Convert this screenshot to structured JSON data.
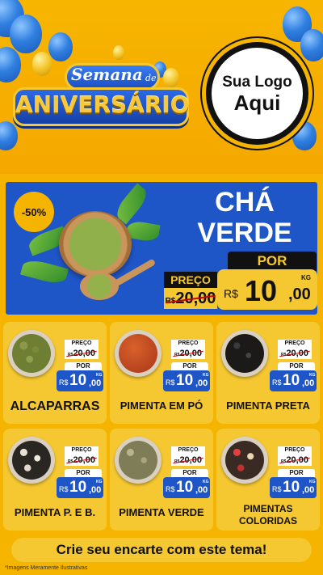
{
  "header": {
    "semana_label": "Semana",
    "de_label": "de",
    "aniversario_label": "ANIVERSÁRIO",
    "logo_line1": "Sua Logo",
    "logo_line2": "Aqui"
  },
  "hero": {
    "discount": "-50%",
    "title_line1": "CHÁ",
    "title_line2": "VERDE",
    "preco_label": "PREÇO",
    "old_currency": "R$",
    "old_price": "20,00",
    "por_label": "POR",
    "currency": "R$",
    "price_int": "10",
    "price_cents": ",00",
    "unit": "KG"
  },
  "price_labels": {
    "preco": "PREÇO",
    "por": "POR",
    "currency_small": "R$",
    "currency": "R$",
    "old_price": "20,00",
    "price_int": "10",
    "price_cents": ",00",
    "unit": "KG"
  },
  "products": [
    {
      "name": "ALCAPARRAS"
    },
    {
      "name": "PIMENTA EM PÓ"
    },
    {
      "name": "PIMENTA PRETA"
    },
    {
      "name": "PIMENTA P. E B."
    },
    {
      "name": "PIMENTA VERDE"
    },
    {
      "name_line1": "PIMENTAS",
      "name_line2": "COLORIDAS"
    }
  ],
  "footer": {
    "cta": "Crie seu encarte com este tema!",
    "footnote": "*Imagens Meramente Ilustrativas"
  },
  "colors": {
    "background": "#f5b400",
    "brand_blue": "#1f56c7",
    "yellow": "#f5c730"
  }
}
